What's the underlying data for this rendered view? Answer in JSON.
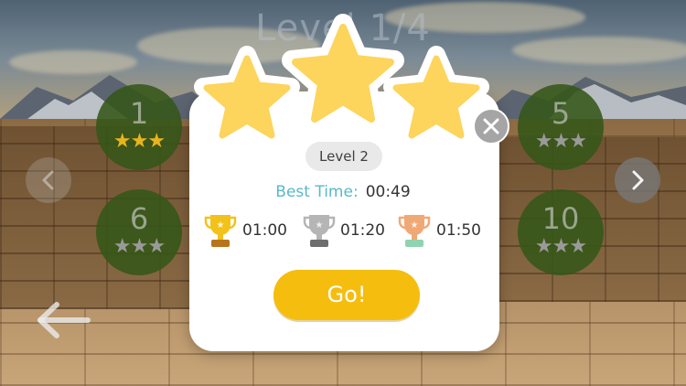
{
  "background_title": "Level 1/4",
  "levels": [
    {
      "id": "1",
      "number": "1",
      "stars": [
        "gold",
        "gold",
        "gold"
      ]
    },
    {
      "id": "6",
      "number": "6",
      "stars": [
        "grey",
        "grey",
        "grey"
      ]
    },
    {
      "id": "5",
      "number": "5",
      "stars": [
        "grey",
        "grey",
        "grey"
      ]
    },
    {
      "id": "10",
      "number": "10",
      "stars": [
        "grey",
        "grey",
        "grey"
      ]
    }
  ],
  "navigation": {
    "prev_icon": "chevron-left-icon",
    "next_icon": "chevron-right-icon",
    "back_icon": "arrow-left-icon"
  },
  "modal": {
    "level_label": "Level 2",
    "rating": {
      "earned": 3,
      "total": 3
    },
    "best_time_label": "Best Time:",
    "best_time_value": "00:49",
    "trophies": [
      {
        "tier": "gold",
        "time": "01:00",
        "color": "#f2c21b"
      },
      {
        "tier": "silver",
        "time": "01:20",
        "color": "#b5b5b5"
      },
      {
        "tier": "bronze",
        "time": "01:50",
        "color": "#f0a875"
      }
    ],
    "go_label": "Go!",
    "close_icon": "close-icon"
  },
  "colors": {
    "accent_yellow": "#f5bd0e",
    "star_yellow": "#fdd45c",
    "best_time_label": "#5bb8c7",
    "level_bubble_bg": "#345618"
  }
}
